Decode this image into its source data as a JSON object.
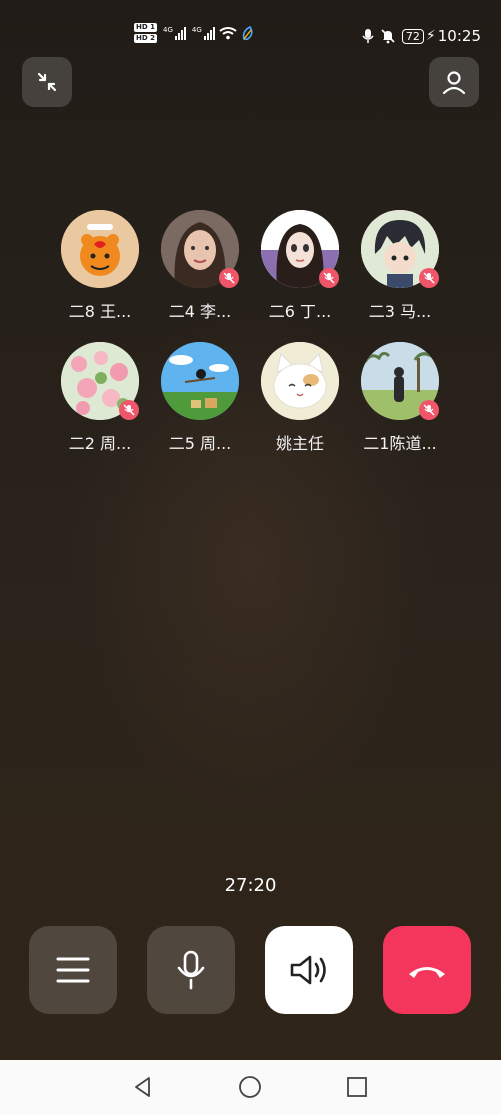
{
  "status_bar": {
    "sim1": "HD 1",
    "sim2": "HD 2",
    "network1": "4G",
    "network2": "4G",
    "battery": "72",
    "time": "10:25"
  },
  "participants": [
    {
      "name": "二8 王...",
      "muted": false,
      "avatar_theme": "tiger"
    },
    {
      "name": "二4  李...",
      "muted": true,
      "avatar_theme": "woman-portrait"
    },
    {
      "name": "二6 丁...",
      "muted": true,
      "avatar_theme": "cartoon-girl"
    },
    {
      "name": "二3  马...",
      "muted": true,
      "avatar_theme": "cartoon-boy"
    },
    {
      "name": "二2 周...",
      "muted": true,
      "avatar_theme": "flowers"
    },
    {
      "name": "二5 周...",
      "muted": false,
      "avatar_theme": "witch-landscape"
    },
    {
      "name": "姚主任",
      "muted": false,
      "avatar_theme": "cat"
    },
    {
      "name": "二1陈道...",
      "muted": true,
      "avatar_theme": "field-girl"
    }
  ],
  "call": {
    "duration": "27:20"
  },
  "colors": {
    "end_call": "#f5365c",
    "muted_badge": "#f0566a",
    "speaker_bg": "#ffffff"
  }
}
